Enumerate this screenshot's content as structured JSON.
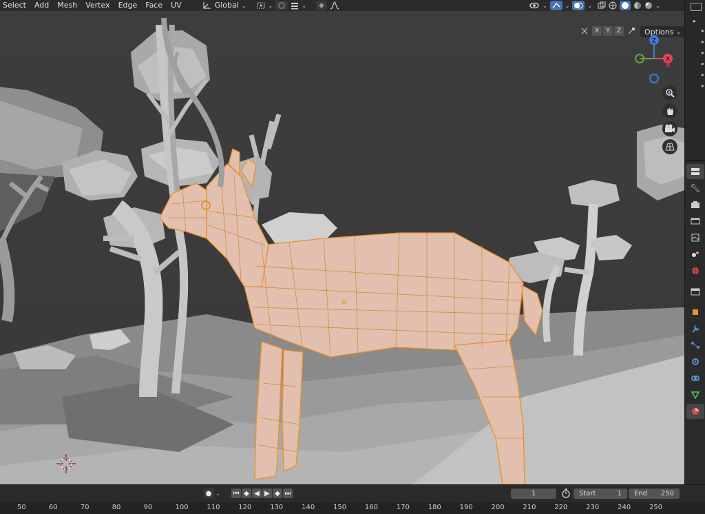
{
  "menu": [
    {
      "name": "menu-select",
      "label": "Select"
    },
    {
      "name": "menu-add",
      "label": "Add"
    },
    {
      "name": "menu-mesh",
      "label": "Mesh"
    },
    {
      "name": "menu-vertex",
      "label": "Vertex"
    },
    {
      "name": "menu-edge",
      "label": "Edge"
    },
    {
      "name": "menu-face",
      "label": "Face"
    },
    {
      "name": "menu-uv",
      "label": "UV"
    }
  ],
  "toolbar": {
    "transform_orientation": "Global"
  },
  "viewport_header": {
    "axis_x": "X",
    "axis_y": "Y",
    "axis_z": "Z",
    "options_label": "Options"
  },
  "gizmo": {
    "z_label": "Z",
    "x_label": "X",
    "colors": {
      "x": "#e84458",
      "y": "#6aa63a",
      "z": "#3d7ed6"
    }
  },
  "timeline": {
    "current_frame": "1",
    "start_label": "Start",
    "start_value": "1",
    "end_label": "End",
    "end_value": "250"
  },
  "ruler_ticks": [
    "50",
    "60",
    "70",
    "80",
    "90",
    "100",
    "110",
    "120",
    "130",
    "140",
    "150",
    "160",
    "170",
    "180",
    "190",
    "200",
    "210",
    "220",
    "230",
    "240",
    "250"
  ],
  "colors": {
    "selection": "#e8922a",
    "header_bg": "#2b2b2b",
    "viewport_bg": "#3d3d3d"
  }
}
